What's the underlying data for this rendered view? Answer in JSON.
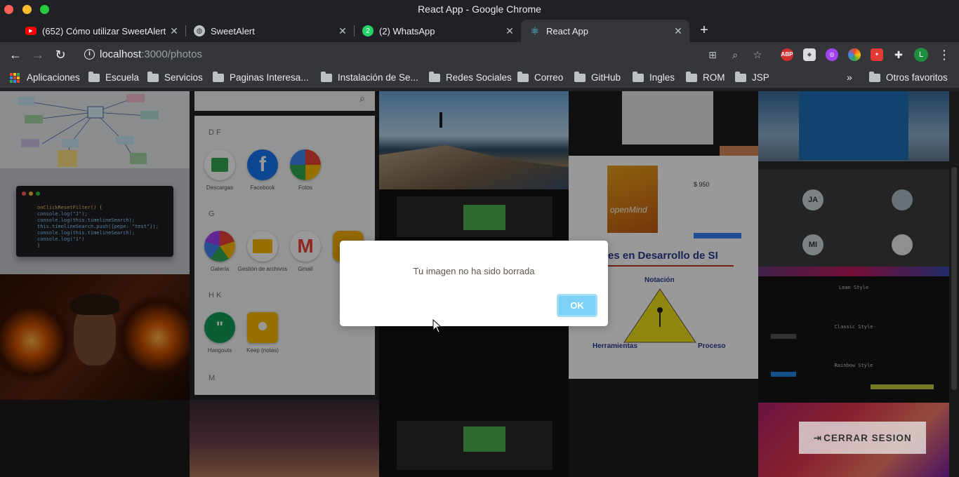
{
  "window": {
    "title": "React App - Google Chrome"
  },
  "tabs": [
    {
      "label": "(652) Cómo utilizar SweetAlert",
      "icon": "youtube-icon",
      "active": false
    },
    {
      "label": "SweetAlert",
      "icon": "globe-icon",
      "active": false
    },
    {
      "label": "(2) WhatsApp",
      "icon": "whatsapp-icon",
      "active": false
    },
    {
      "label": "React App",
      "icon": "react-icon",
      "active": true
    }
  ],
  "toolbar": {
    "url_host": "localhost",
    "url_path": ":3000/photos",
    "extensions": [
      "translate-icon",
      "zoom-icon",
      "star-icon",
      "adblock-icon",
      "cube-icon",
      "purple-extension-icon",
      "color-ring-icon",
      "red-extension-icon",
      "puzzle-icon"
    ],
    "adblock_label": "ABP",
    "profile_initial": "L"
  },
  "bookmarks": {
    "apps_label": "Aplicaciones",
    "items": [
      "Escuela",
      "Servicios",
      "Paginas Interesa...",
      "Instalación de Se...",
      "Redes Sociales",
      "Correo",
      "GitHub",
      "Ingles",
      "ROM",
      "JSP"
    ],
    "more": "»",
    "other": "Otros favoritos"
  },
  "gallery": {
    "code_lines": [
      "onClickResetFilter() {",
      "  console.log(\"J\");",
      "  console.log(this.timelineSearch);",
      "  this.timelineSearch.push({pepe: \"test\"});",
      "  console.log(this.timelineSearch);",
      "  console.log(\"1\")",
      "}"
    ],
    "apps_sections": [
      "D F",
      "G",
      "H K",
      "M"
    ],
    "apps": [
      "Descargas",
      "Facebook",
      "Fotos",
      "Galería",
      "Gestión de archivos",
      "Gmail",
      "Hangouts",
      "Keep (notas)"
    ],
    "slide_title": "es en Desarrollo de SI",
    "slide_labels": [
      "Notación",
      "Herramientas",
      "Proceso"
    ],
    "book_title": "openMind",
    "book_price": "$ 950",
    "meeting_avatars": [
      "JA",
      "MI"
    ],
    "terminal_title_1": "Lean Style",
    "terminal_title_2": "Classic Style",
    "terminal_title_3": "Rainbow Style"
  },
  "alert": {
    "message": "Tu imagen no ha sido borrada",
    "ok_label": "OK"
  },
  "logout": {
    "label": "CERRAR SESION"
  }
}
